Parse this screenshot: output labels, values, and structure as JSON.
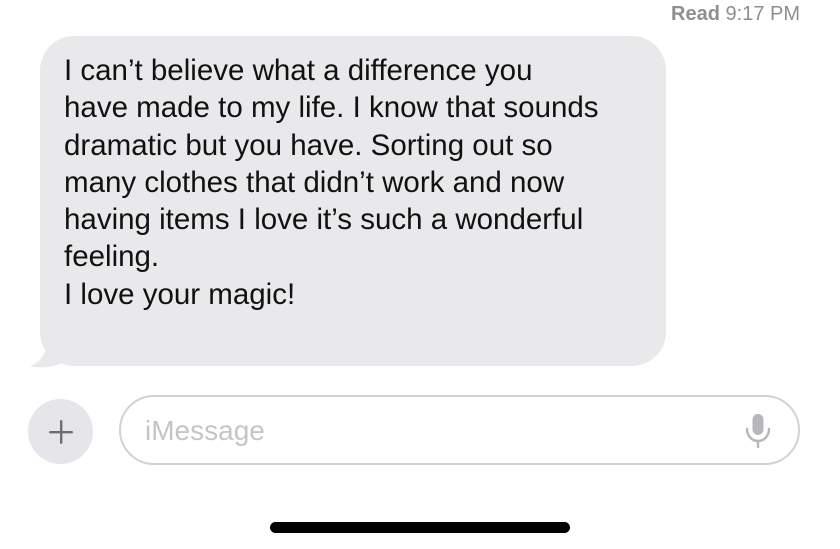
{
  "receipt": {
    "label": "Read",
    "time": "9:17 PM"
  },
  "message": {
    "lines": [
      "I can’t believe what a difference you",
      "have made to my life. I know that sounds",
      "dramatic but you have. Sorting out so",
      "many clothes that didn’t work and now",
      "having items I love it’s such a wonderful",
      "feeling.",
      "I love your magic!"
    ],
    "bubble_color": "#e9e9eb"
  },
  "compose": {
    "placeholder": "iMessage",
    "value": "",
    "plus_icon": "plus-icon",
    "mic_icon": "microphone-icon"
  }
}
